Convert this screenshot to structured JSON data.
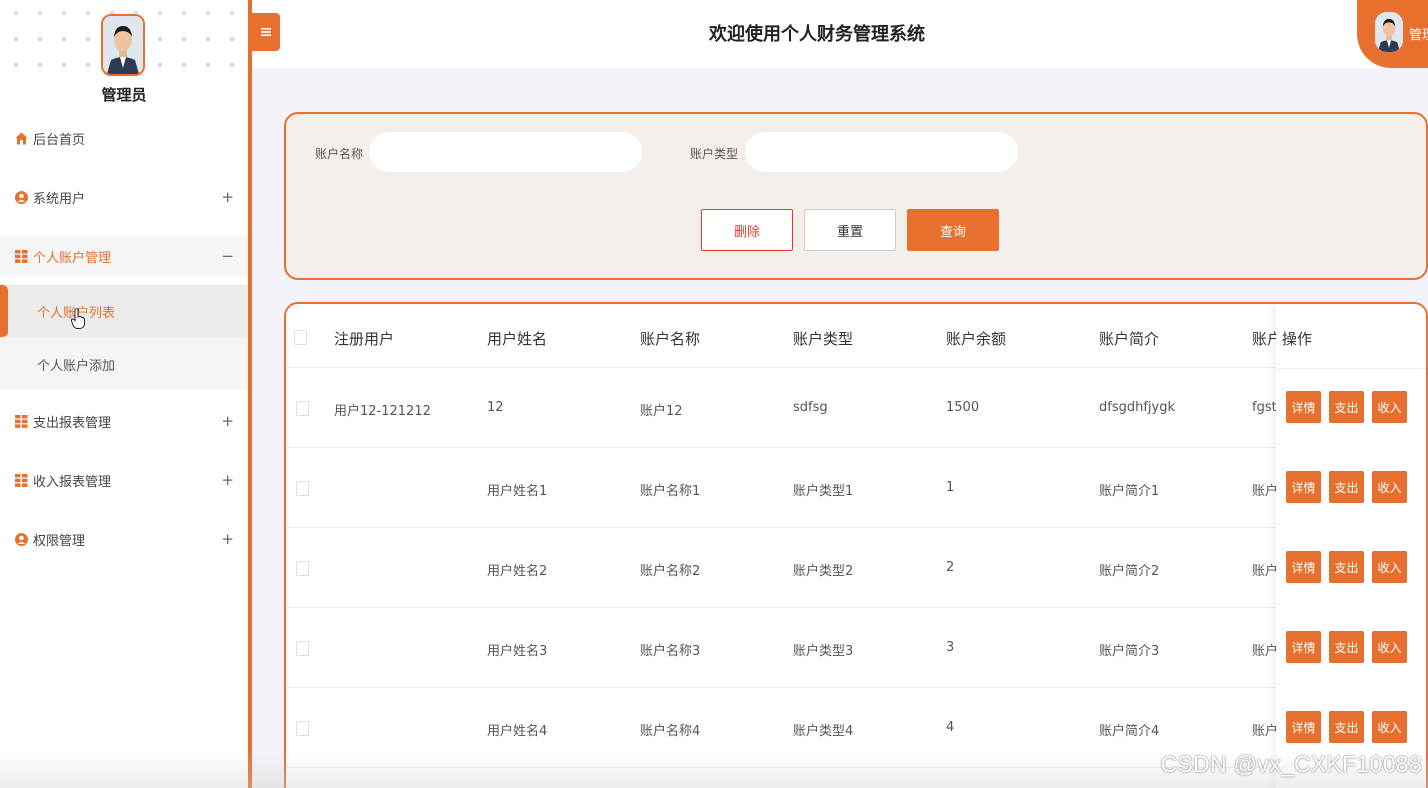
{
  "header": {
    "title": "欢迎使用个人财务管理系统",
    "menu_toggle_icon": "hamburger-icon",
    "user_label": "管理"
  },
  "sidebar": {
    "role": "管理员",
    "items": [
      {
        "label": "后台首页",
        "icon": "home-icon",
        "toggle": ""
      },
      {
        "label": "系统用户",
        "icon": "user-icon",
        "toggle": "+"
      },
      {
        "label": "个人账户管理",
        "icon": "grid-icon",
        "toggle": "−"
      },
      {
        "label": "支出报表管理",
        "icon": "grid-icon",
        "toggle": "+"
      },
      {
        "label": "收入报表管理",
        "icon": "grid-icon",
        "toggle": "+"
      },
      {
        "label": "权限管理",
        "icon": "user-icon",
        "toggle": "+"
      }
    ],
    "subitems": [
      {
        "label": "个人账户列表"
      },
      {
        "label": "个人账户添加"
      }
    ]
  },
  "search": {
    "account_name_label": "账户名称",
    "account_name_value": "",
    "account_type_label": "账户类型",
    "account_type_value": "",
    "delete_label": "删除",
    "reset_label": "重置",
    "query_label": "查询"
  },
  "table": {
    "columns": [
      "注册用户",
      "用户姓名",
      "账户名称",
      "账户类型",
      "账户余额",
      "账户简介",
      "账户",
      "操作"
    ],
    "rows": [
      {
        "user": "用户12-121212",
        "name": "12",
        "account": "账户12",
        "type": "sdfsg",
        "balance": "1500",
        "intro": "dfsgdhfjygk",
        "extra": "fgstr"
      },
      {
        "user": "",
        "name": "用户姓名1",
        "account": "账户名称1",
        "type": "账户类型1",
        "balance": "1",
        "intro": "账户简介1",
        "extra": "账户i"
      },
      {
        "user": "",
        "name": "用户姓名2",
        "account": "账户名称2",
        "type": "账户类型2",
        "balance": "2",
        "intro": "账户简介2",
        "extra": "账户i"
      },
      {
        "user": "",
        "name": "用户姓名3",
        "account": "账户名称3",
        "type": "账户类型3",
        "balance": "3",
        "intro": "账户简介3",
        "extra": "账户i"
      },
      {
        "user": "",
        "name": "用户姓名4",
        "account": "账户名称4",
        "type": "账户类型4",
        "balance": "4",
        "intro": "账户简介4",
        "extra": "账户i"
      }
    ],
    "ops": {
      "detail": "详情",
      "expense": "支出",
      "income": "收入"
    }
  },
  "watermark": "CSDN @vx_CXKF10088",
  "colors": {
    "accent": "#e8702f",
    "danger": "#e23b2e",
    "panel_bg": "#f5efec"
  }
}
